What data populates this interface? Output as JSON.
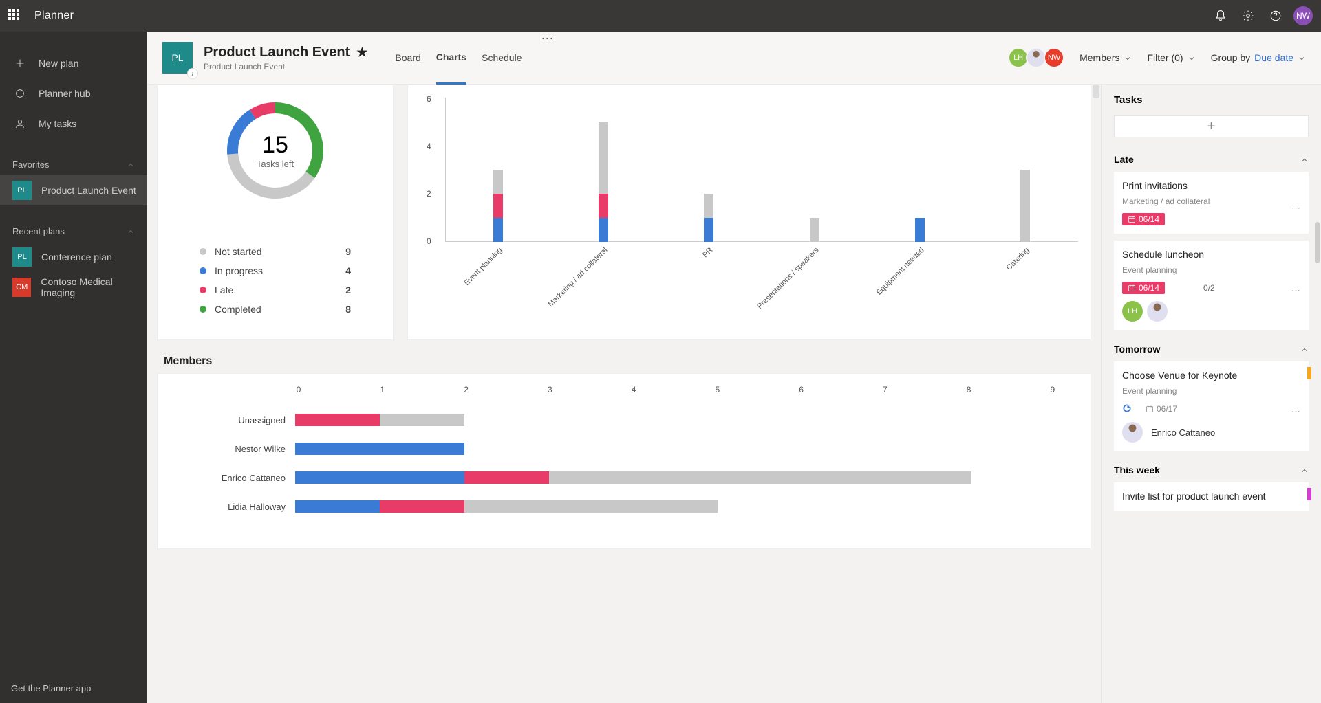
{
  "app": {
    "name": "Planner",
    "user_initials": "NW"
  },
  "sidebar": {
    "items": [
      {
        "label": "New plan"
      },
      {
        "label": "Planner hub"
      },
      {
        "label": "My tasks"
      }
    ],
    "favorites_label": "Favorites",
    "recent_label": "Recent plans",
    "favorites": [
      {
        "label": "Product Launch Event",
        "short": "PL",
        "bg": "#1f8a8a",
        "selected": true
      }
    ],
    "recent": [
      {
        "label": "Conference plan",
        "short": "PL",
        "bg": "#1f8a8a"
      },
      {
        "label": "Contoso Medical Imaging",
        "short": "CM",
        "bg": "#d63a2a"
      }
    ],
    "footer": "Get the Planner app"
  },
  "header": {
    "plan_short": "PL",
    "plan_title": "Product Launch Event",
    "plan_sub": "Product Launch Event",
    "tabs": [
      {
        "label": "Board"
      },
      {
        "label": "Charts",
        "active": true
      },
      {
        "label": "Schedule"
      }
    ],
    "members_label": "Members",
    "filter_label": "Filter (0)",
    "group_label": "Group by",
    "group_value": "Due date",
    "avatars": [
      {
        "bg": "#8bc34a",
        "text": "LH"
      },
      {
        "bg": "#d7d7e8",
        "text": "",
        "img": true
      },
      {
        "bg": "#e83b2a",
        "text": "NW"
      }
    ]
  },
  "status": {
    "tasks_left_num": "15",
    "tasks_left_label": "Tasks left",
    "legend": [
      {
        "label": "Not started",
        "value": "9",
        "color": "#c8c8c8"
      },
      {
        "label": "In progress",
        "value": "4",
        "color": "#3a7bd5"
      },
      {
        "label": "Late",
        "value": "2",
        "color": "#e83b68"
      },
      {
        "label": "Completed",
        "value": "8",
        "color": "#3fa33f"
      }
    ]
  },
  "buckets": {
    "ymax": 6,
    "yticks": [
      "0",
      "2",
      "4",
      "6"
    ],
    "categories": [
      "Event planning",
      "Marketing / ad collateral",
      "PR",
      "Presentations / speakers",
      "Equipment needed",
      "Catering"
    ]
  },
  "members_section": {
    "title": "Members"
  },
  "members_chart": {
    "xticks": [
      "0",
      "1",
      "2",
      "3",
      "4",
      "5",
      "6",
      "7",
      "8",
      "9"
    ],
    "names": [
      "Unassigned",
      "Nestor Wilke",
      "Enrico Cattaneo",
      "Lidia Halloway"
    ]
  },
  "rpanel": {
    "tasks_label": "Tasks",
    "sections": {
      "late": "Late",
      "tomorrow": "Tomorrow",
      "thisweek": "This week"
    },
    "late": [
      {
        "title": "Print invitations",
        "bucket": "Marketing / ad collateral",
        "due": "06/14"
      },
      {
        "title": "Schedule luncheon",
        "bucket": "Event planning",
        "due": "06/14",
        "checklist": "0/2",
        "assignees": [
          {
            "bg": "#8bc34a",
            "text": "LH"
          },
          {
            "bg": "#e0dff0",
            "text": "",
            "img": true
          }
        ]
      }
    ],
    "tomorrow": [
      {
        "title": "Choose Venue for Keynote",
        "bucket": "Event planning",
        "due": "06/17",
        "assignee_name": "Enrico Cattaneo",
        "assignee_bg": "#e0dff0",
        "color_tab": "#f5a623"
      }
    ],
    "thisweek": [
      {
        "title": "Invite list for product launch event",
        "color_tab": "#d040d0"
      }
    ]
  },
  "chart_data": [
    {
      "type": "pie",
      "title": "Tasks left",
      "center_value": 15,
      "series": [
        {
          "name": "Not started",
          "value": 9,
          "color": "#c8c8c8"
        },
        {
          "name": "In progress",
          "value": 4,
          "color": "#3a7bd5"
        },
        {
          "name": "Late",
          "value": 2,
          "color": "#e83b68"
        },
        {
          "name": "Completed",
          "value": 8,
          "color": "#3fa33f"
        }
      ]
    },
    {
      "type": "bar",
      "title": "Tasks by bucket",
      "stacked": true,
      "categories": [
        "Event planning",
        "Marketing / ad collateral",
        "PR",
        "Presentations / speakers",
        "Equipment needed",
        "Catering"
      ],
      "ylim": [
        0,
        6
      ],
      "series": [
        {
          "name": "In progress",
          "color": "#3a7bd5",
          "values": [
            1,
            1,
            1,
            0,
            1,
            0
          ]
        },
        {
          "name": "Late",
          "color": "#e83b68",
          "values": [
            1,
            1,
            0,
            0,
            0,
            0
          ]
        },
        {
          "name": "Not started",
          "color": "#c8c8c8",
          "values": [
            1,
            3,
            1,
            1,
            0,
            3
          ]
        }
      ]
    },
    {
      "type": "bar",
      "orientation": "horizontal",
      "title": "Members",
      "stacked": true,
      "categories": [
        "Unassigned",
        "Nestor Wilke",
        "Enrico Cattaneo",
        "Lidia Halloway"
      ],
      "xlim": [
        0,
        9
      ],
      "series": [
        {
          "name": "In progress",
          "color": "#3a7bd5",
          "values": [
            0,
            2,
            2,
            1
          ]
        },
        {
          "name": "Late",
          "color": "#e83b68",
          "values": [
            1,
            0,
            1,
            1
          ]
        },
        {
          "name": "Not started",
          "color": "#c8c8c8",
          "values": [
            1,
            0,
            5,
            3
          ]
        }
      ]
    }
  ]
}
